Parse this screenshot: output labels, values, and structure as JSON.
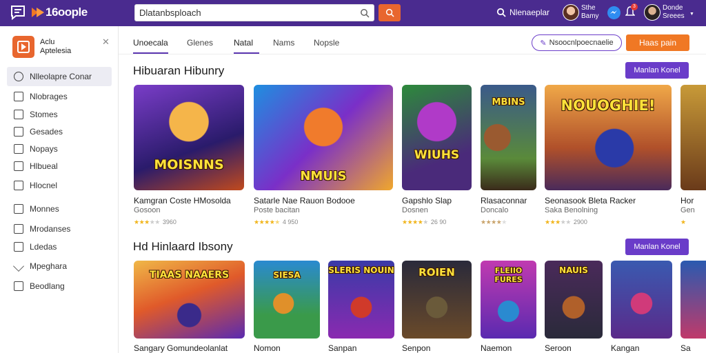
{
  "topbar": {
    "logo_text": "16oople",
    "search_value": "Dlatanbsploach",
    "search_label": "Nlenaeplar",
    "user1": {
      "line1": "Sthe",
      "line2": "Bamy"
    },
    "user2": {
      "line1": "Donde",
      "line2": "Sreees"
    },
    "notif_count": "3"
  },
  "sidebar": {
    "app_title_1": "Aclu",
    "app_title_2": "Aptelesia",
    "items": [
      {
        "label": "Nlleolapre Conar"
      },
      {
        "label": "Nlobrages"
      },
      {
        "label": "Stomes"
      },
      {
        "label": "Gesades"
      },
      {
        "label": "Nopays"
      },
      {
        "label": "Hlbueal"
      },
      {
        "label": "Hlocnel"
      },
      {
        "label": "Monnes"
      },
      {
        "label": "Mrodanses"
      },
      {
        "label": "Ldedas"
      },
      {
        "label": "Mpeghara"
      },
      {
        "label": "Beodlang"
      }
    ]
  },
  "tabs": [
    {
      "label": "Unoecala"
    },
    {
      "label": "Glenes"
    },
    {
      "label": "Natal"
    },
    {
      "label": "Nams"
    },
    {
      "label": "Nopsle"
    }
  ],
  "actions": {
    "outline_button": "Nsoocnlpoecnaelie",
    "orange_button": "Haas pain"
  },
  "section1": {
    "title": "Hibuaran Hibunry",
    "more": "Manlan Konel",
    "cards": [
      {
        "name": "Kamgran Coste HMosolda",
        "sub": "Gosoon",
        "rating": 3.5,
        "count": "3960",
        "art": "MOISNNS"
      },
      {
        "name": "Satarle Nae Rauon Bodooe",
        "sub": "Poste bacitan",
        "rating": 4.5,
        "count": "4 950",
        "art": "NMUIS"
      },
      {
        "name": "Gapshlo Slap",
        "sub": "Dosnen",
        "rating": 4.0,
        "count": "26 90",
        "art": "WIUHS"
      },
      {
        "name": "Rlasaconnar",
        "sub": "Doncalo",
        "rating": 4.0,
        "count": "",
        "art": "MBINS"
      },
      {
        "name": "Seonasook Bleta Racker",
        "sub": "Saka Benolning",
        "rating": 3.5,
        "count": "2900",
        "art": "NOUOGHIE!"
      },
      {
        "name": "Hor",
        "sub": "Gen",
        "rating": 1.0,
        "count": "",
        "art": ""
      }
    ]
  },
  "section2": {
    "title": "Hd Hinlaard Ibsony",
    "more": "Manlan Konel",
    "cards": [
      {
        "name": "Sangary Gomundeolanlat",
        "art": "TIAAS NAAERS"
      },
      {
        "name": "Nomon",
        "art": "SIESA"
      },
      {
        "name": "Sanpan",
        "art": "SLERIS NOUIN"
      },
      {
        "name": "Senpon",
        "art": "ROIEN"
      },
      {
        "name": "Naemon",
        "art": "FLEIIO FURES"
      },
      {
        "name": "Seroon",
        "art": "NAUIS"
      },
      {
        "name": "Kangan",
        "art": ""
      },
      {
        "name": "Sa",
        "art": ""
      }
    ]
  },
  "colors": {
    "topbar": "#4a2b8f",
    "accent_purple": "#6a3cc9",
    "accent_orange": "#f07824",
    "star": "#f1b51c"
  }
}
